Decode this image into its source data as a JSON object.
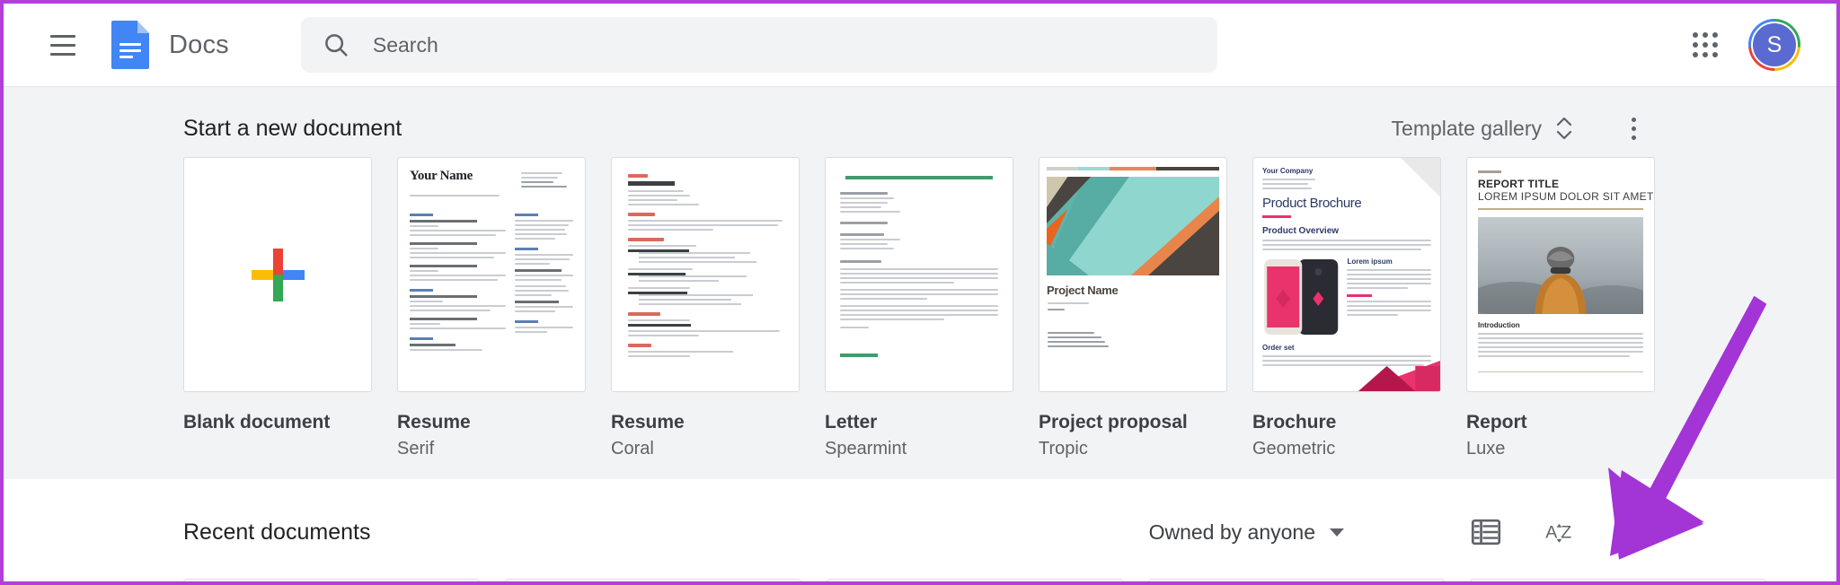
{
  "header": {
    "menu_icon": "hamburger-menu-icon",
    "app_logo_icon": "google-docs-logo-icon",
    "app_title": "Docs",
    "search": {
      "icon": "search-icon",
      "placeholder": "Search",
      "value": ""
    },
    "apps_icon": "google-apps-grid-icon",
    "avatar_initial": "S"
  },
  "templates_section": {
    "heading": "Start a new document",
    "gallery_label": "Template gallery",
    "gallery_toggle_icon": "chevron-up-down-icon",
    "more_icon": "more-vertical-icon",
    "items": [
      {
        "name": "Blank document",
        "subtitle": "",
        "thumb": "blank-plus"
      },
      {
        "name": "Resume",
        "subtitle": "Serif",
        "thumb": "resume-serif"
      },
      {
        "name": "Resume",
        "subtitle": "Coral",
        "thumb": "resume-coral"
      },
      {
        "name": "Letter",
        "subtitle": "Spearmint",
        "thumb": "letter-spearmint"
      },
      {
        "name": "Project proposal",
        "subtitle": "Tropic",
        "thumb": "project-tropic"
      },
      {
        "name": "Brochure",
        "subtitle": "Geometric",
        "thumb": "brochure-geometric"
      },
      {
        "name": "Report",
        "subtitle": "Luxe",
        "thumb": "report-luxe"
      }
    ],
    "thumb_text": {
      "resume_serif_name": "Your Name",
      "project_title": "Project Name",
      "brochure_company": "Your Company",
      "brochure_title": "Product Brochure",
      "brochure_section": "Product Overview",
      "report_title": "REPORT TITLE",
      "report_subtitle": "LOREM IPSUM DOLOR SIT AMET",
      "report_section": "Introduction"
    }
  },
  "recent_section": {
    "title": "Recent documents",
    "owner_filter_label": "Owned by anyone",
    "owner_filter_caret_icon": "caret-down-icon",
    "list_view_icon": "list-view-icon",
    "sort_icon": "sort-az-icon",
    "folder_icon": "folder-picker-icon"
  },
  "annotation": {
    "arrow_color": "#a334d6",
    "points_to": "folder-picker-icon"
  },
  "colors": {
    "brand_blue": "#4285f4",
    "brand_red": "#ea4335",
    "brand_yellow": "#fbbc05",
    "brand_green": "#34a853",
    "panel_bg": "#f1f3f4",
    "text_primary": "#202124",
    "text_secondary": "#5f6368",
    "border_highlight": "#b23fd8"
  }
}
